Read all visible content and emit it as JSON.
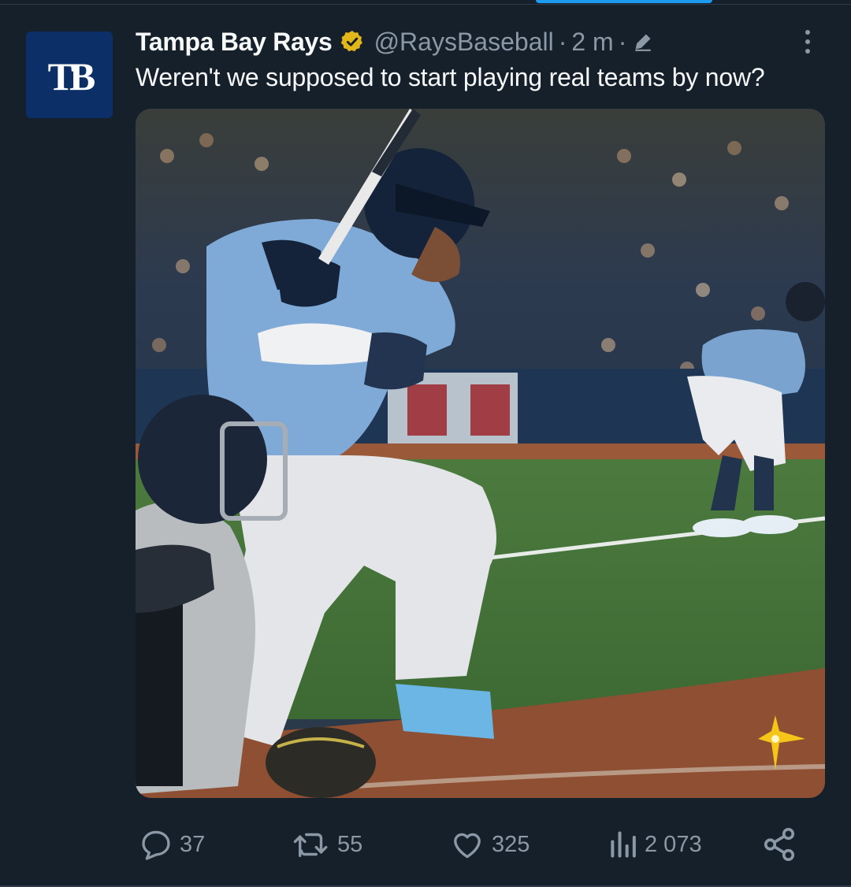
{
  "tweet": {
    "display_name": "Tampa Bay Rays",
    "handle": "@RaysBaseball",
    "separator": "·",
    "time": "2 m",
    "text": "Weren't we supposed to start playing real teams by now?",
    "avatar_initials": "TB"
  },
  "icons": {
    "verified": "verified-badge-icon",
    "edit": "edited-pencil-icon",
    "more": "more-vertical-icon",
    "reply": "reply-icon",
    "retweet": "retweet-icon",
    "like": "heart-icon",
    "views": "views-bar-chart-icon",
    "share": "share-icon"
  },
  "actions": {
    "replies": "37",
    "retweets": "55",
    "likes": "325",
    "views": "2 073"
  },
  "colors": {
    "background": "#15202b",
    "text_primary": "#f7f9f9",
    "text_secondary": "#8b98a5",
    "verified_gold": "#e2b719",
    "accent": "#1d9bf0",
    "avatar_bg": "#0b2f66"
  }
}
